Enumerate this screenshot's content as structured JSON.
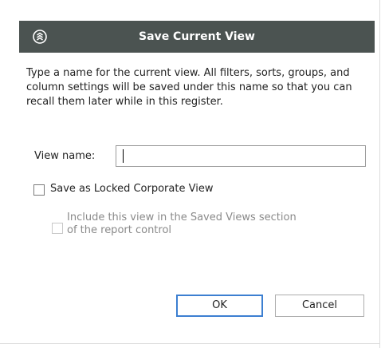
{
  "dialog": {
    "title": "Save Current View",
    "description": "Type a name for the current view.  All filters, sorts, groups, and column settings will be saved under this name so that you can recall them later while in this register.",
    "view_name_label": "View name:",
    "view_name_value": "",
    "locked_checkbox_label": "Save as Locked Corporate View",
    "include_checkbox_label": "Include this view in the Saved Views section of the report control",
    "ok_label": "OK",
    "cancel_label": "Cancel"
  },
  "icons": {
    "title_icon": "app-logo-icon"
  },
  "colors": {
    "titlebar": "#4b5351",
    "title_text": "#ffffff",
    "default_button_border": "#3c7fd1",
    "disabled_text": "#8a8a8a"
  },
  "state": {
    "locked_checked": false,
    "include_checked": false,
    "include_enabled": false
  }
}
